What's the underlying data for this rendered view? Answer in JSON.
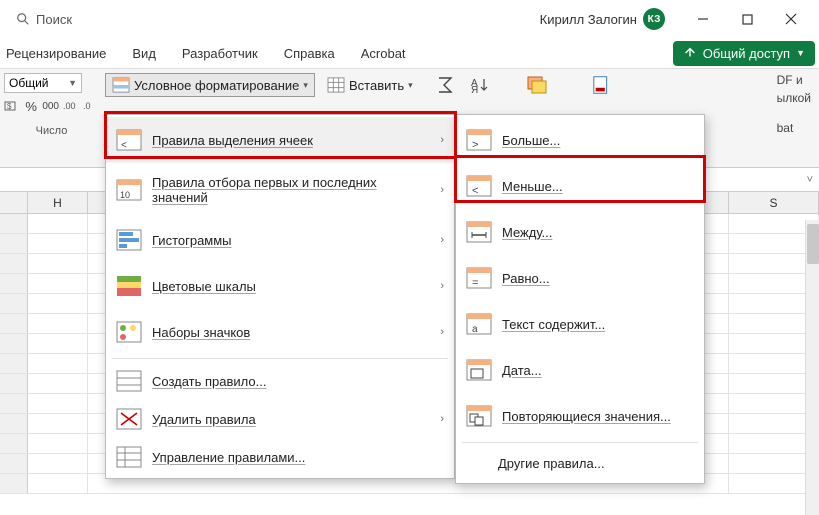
{
  "titlebar": {
    "search_placeholder": "Поиск",
    "user_name": "Кирилл Залогин",
    "user_initials": "КЗ"
  },
  "tabs": [
    "Рецензирование",
    "Вид",
    "Разработчик",
    "Справка",
    "Acrobat"
  ],
  "share_label": "Общий доступ",
  "ribbon": {
    "number_format": "Общий",
    "number_group_label": "Число",
    "percent": "%",
    "thousands": "000",
    "dec_inc": ".0→",
    "dec_dec": "←.0",
    "cf_label": "Условное форматирование",
    "insert_label": "Вставить",
    "pdf_line1": "DF и",
    "pdf_line2": "ылкой",
    "pdf_line3": "bat"
  },
  "columns": {
    "first": "H",
    "last": "S"
  },
  "menu1": {
    "items": [
      "Правила выделения ячеек",
      "Правила отбора первых и последних значений",
      "Гистограммы",
      "Цветовые шкалы",
      "Наборы значков"
    ],
    "create": "Создать правило...",
    "clear": "Удалить правила",
    "manage": "Управление правилами..."
  },
  "menu2": {
    "items": [
      "Больше...",
      "Меньше...",
      "Между...",
      "Равно...",
      "Текст содержит...",
      "Дата...",
      "Повторяющиеся значения..."
    ],
    "other": "Другие правила..."
  }
}
